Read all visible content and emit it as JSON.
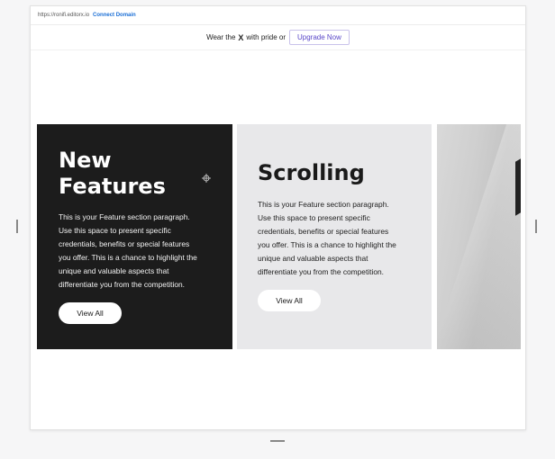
{
  "topbar": {
    "url": "https://ronifi.editorx.io",
    "connect_label": "Connect Domain"
  },
  "banner": {
    "text_before": "Wear the",
    "x_mark": "X",
    "text_after": "with pride or",
    "upgrade_label": "Upgrade Now"
  },
  "cards": [
    {
      "title": "New Features",
      "paragraph": "This is your Feature section paragraph. Use this space to present specific credentials, benefits or special features you offer. This is a chance to highlight the unique and valuable aspects that differentiate you from the competition.",
      "button_label": "View All"
    },
    {
      "title": "Scrolling",
      "paragraph": "This is your Feature section paragraph. Use this space to present specific credentials, benefits or special features you offer. This is a chance to highlight the unique and valuable aspects that differentiate you from the competition.",
      "button_label": "View All"
    }
  ],
  "colors": {
    "dark_card": "#1c1c1c",
    "light_card": "#e8e8ea",
    "link": "#1b6fd6",
    "upgrade": "#5a47c8"
  }
}
